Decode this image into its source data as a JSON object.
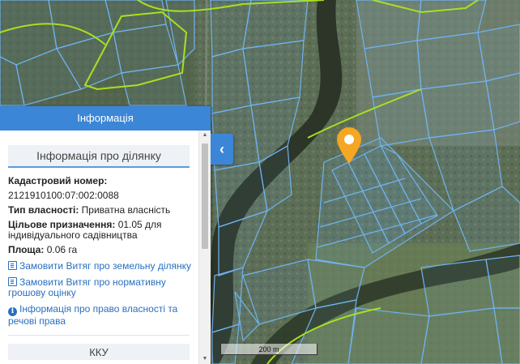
{
  "panel": {
    "header": "Інформація",
    "section_title": "Інформація про ділянку",
    "cadastral_label": "Кадастровий номер:",
    "cadastral_value": "2121910100:07:002:0088",
    "ownership_label": "Тип власності:",
    "ownership_value": "Приватна власність",
    "purpose_label": "Цільове призначення:",
    "purpose_value": "01.05 для індивідуального садівництва",
    "area_label": "Площа:",
    "area_value": "0.06 га",
    "links": [
      {
        "text": "Замовити Витяг про земельну ділянку",
        "icon": "document-icon"
      },
      {
        "text": "Замовити Витяг про нормативну грошову оцінку",
        "icon": "document-icon"
      },
      {
        "text": "Інформація про право власності та речові права",
        "icon": "info-icon"
      }
    ],
    "next_section_title": "ККУ"
  },
  "map": {
    "scale_label": "200 m",
    "parcel_color": "#6fb3f0",
    "boundary_color": "#a8e020",
    "river_color": "#2c3527",
    "marker_color": "#f5a623"
  }
}
